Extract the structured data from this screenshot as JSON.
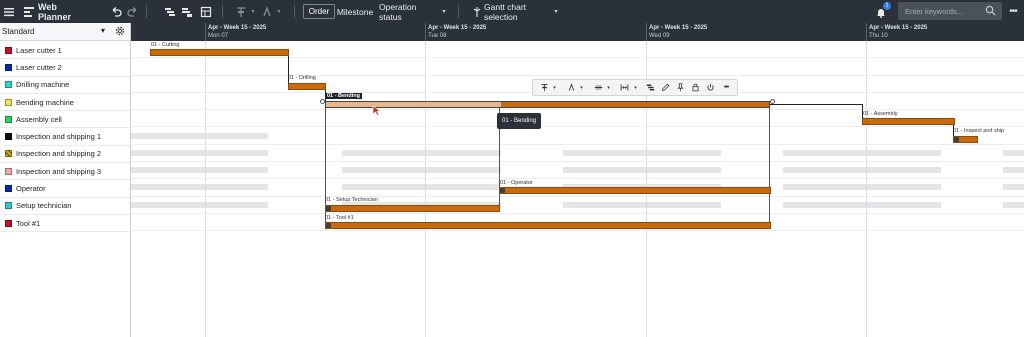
{
  "app": {
    "title": "Web Planner",
    "notification_count": "1"
  },
  "toolbar": {
    "order_label": "Order",
    "milestone_label": "Milestone",
    "operation_status_label": "Operation status",
    "gantt_selection_label": "Gantt chart selection",
    "search_placeholder": "Enter keywords..."
  },
  "sidebar": {
    "view_name": "Standard",
    "resources": [
      {
        "label": "Laser cutter 1",
        "color": "#c8102e"
      },
      {
        "label": "Laser cutter 2",
        "color": "#0a2ca8"
      },
      {
        "label": "Drilling machine",
        "color": "#35d1cf"
      },
      {
        "label": "Bending machine",
        "color": "#f2e34c"
      },
      {
        "label": "Assembly cell",
        "color": "#2bd35a"
      },
      {
        "label": "Inspection and shipping 1",
        "color": "#111111"
      },
      {
        "label": "Inspection and shipping 2",
        "color": "#d9a514"
      },
      {
        "label": "Inspection and shipping 3",
        "color": "#f0a8a8"
      },
      {
        "label": "Operator",
        "color": "#0a2ca8"
      },
      {
        "label": "Setup technician",
        "color": "#35c4d6"
      },
      {
        "label": "Tool #1",
        "color": "#c8102e"
      }
    ]
  },
  "timeline": {
    "days": [
      {
        "week": "Apr - Week 15 - 2025",
        "date": "Mon 07"
      },
      {
        "week": "Apr - Week 15 - 2025",
        "date": "Tue 08"
      },
      {
        "week": "Apr - Week 15 - 2025",
        "date": "Wed 09"
      },
      {
        "week": "Apr - Week 15 - 2025",
        "date": "Thu 10"
      }
    ]
  },
  "operations": {
    "cutting": "01 - Cutting",
    "drilling": "01 - Drilling",
    "bending": "01 - Bending",
    "assembly": "01 - Assembly",
    "inspect": "01 - Inspect and ship",
    "operator": "01 - Operator",
    "setup": "01 - Setup Technician",
    "tool": "01 - Tool #1"
  },
  "tooltip": {
    "text": "01 - Bending"
  }
}
